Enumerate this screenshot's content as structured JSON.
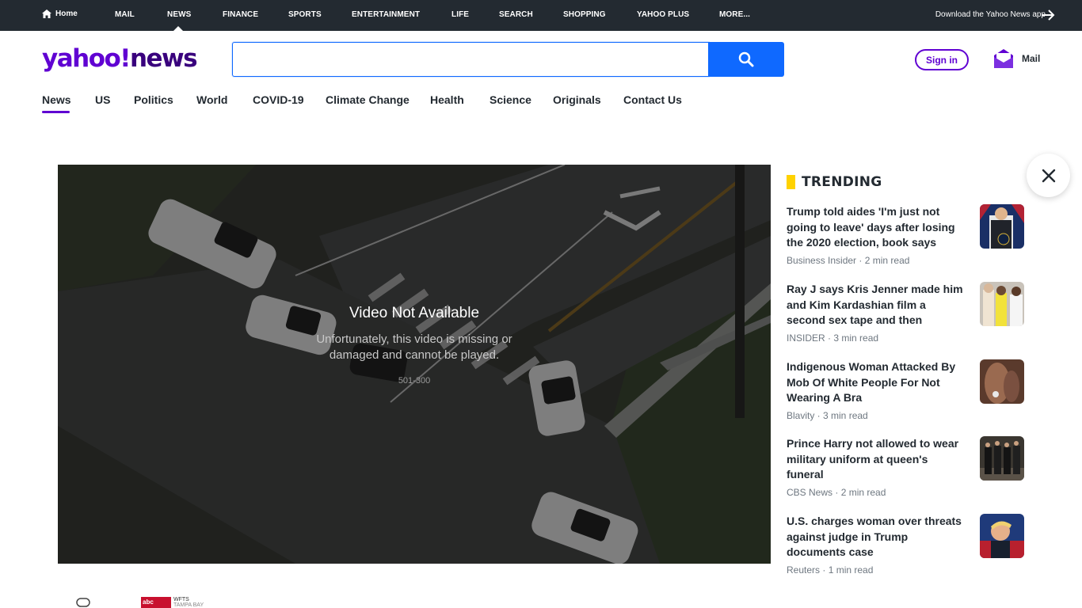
{
  "top_nav": {
    "items": [
      "Home",
      "Mail",
      "News",
      "Finance",
      "Sports",
      "Entertainment",
      "Life",
      "Search",
      "Shopping",
      "Yahoo Plus",
      "More..."
    ],
    "active": "News",
    "download_label": "Download the Yahoo News app"
  },
  "header": {
    "logo_yahoo": "yahoo!",
    "logo_news": "news",
    "search_value": "",
    "signin_label": "Sign in",
    "mail_label": "Mail"
  },
  "section_nav": {
    "items": [
      "News",
      "US",
      "Politics",
      "World",
      "COVID-19",
      "Climate Change",
      "Health",
      "Science",
      "Originals",
      "Contact Us"
    ],
    "active": "News"
  },
  "video": {
    "title": "Video Not Available",
    "message_line1": "Unfortunately, this video is missing or",
    "message_line2": "damaged and cannot be played.",
    "error_code": "501-300"
  },
  "trending": {
    "heading": "TRENDING",
    "items": [
      {
        "title": "Trump told aides 'I'm just not going to leave' days after losing the 2020 election, book says",
        "source": "Business Insider",
        "read_time": "2 min read",
        "thumb": "trump-podium"
      },
      {
        "title": "Ray J says Kris Jenner made him and Kim Kardashian film a second sex tape and then watched both…",
        "source": "INSIDER",
        "read_time": "3 min read",
        "thumb": "red-carpet"
      },
      {
        "title": "Indigenous Woman Attacked By Mob Of White People For Not Wearing A Bra",
        "source": "Blavity",
        "read_time": "3 min read",
        "thumb": "closeup-skin"
      },
      {
        "title": "Prince Harry not allowed to wear military uniform at queen's funeral",
        "source": "CBS News",
        "read_time": "2 min read",
        "thumb": "royals-walking"
      },
      {
        "title": "U.S. charges woman over threats against judge in Trump documents case",
        "source": "Reuters",
        "read_time": "1 min read",
        "thumb": "trump-rally"
      }
    ]
  },
  "bottom": {
    "badge_logo": "abc ACTION NEWS",
    "badge_station": "WFTS",
    "badge_city": "TAMPA BAY"
  },
  "colors": {
    "topnav_bg": "#232a31",
    "brand_purple": "#6001d2",
    "search_blue": "#0f69ff",
    "trending_yellow": "#ffd200"
  }
}
